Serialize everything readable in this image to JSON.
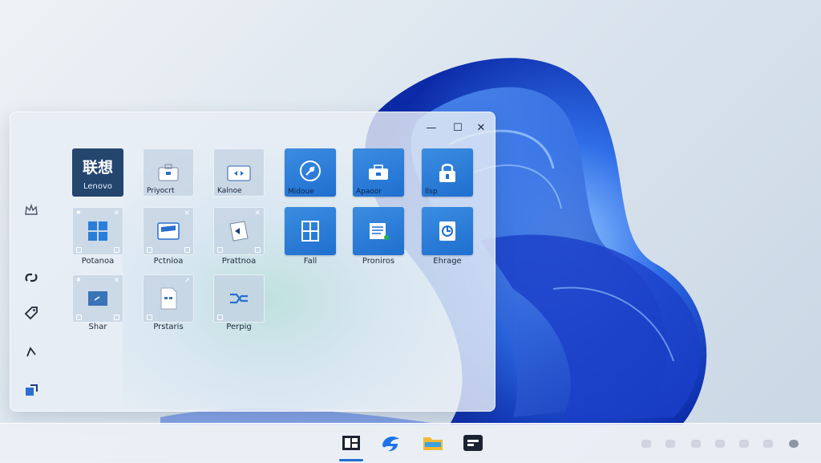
{
  "window": {
    "caption": {
      "minimize": "—",
      "maximize": "☐",
      "close": "✕"
    }
  },
  "rail": [
    {
      "icon": "crown-icon"
    },
    {
      "icon": "link-icon"
    },
    {
      "icon": "tag-icon"
    },
    {
      "icon": "cursor-icon"
    },
    {
      "icon": "export-icon"
    }
  ],
  "tiles": {
    "row1": [
      {
        "name": "lenovo",
        "cn": "联想",
        "en": "Lenovo"
      },
      {
        "name": "project",
        "label": "Priyocrt"
      },
      {
        "name": "kalnoe",
        "label": "Kalnoe"
      },
      {
        "name": "midoue",
        "label": "Midoue"
      },
      {
        "name": "apaoor",
        "label": "Apaoor"
      },
      {
        "name": "lock",
        "label": "Ilsp"
      }
    ],
    "row2": [
      {
        "name": "windows",
        "caption": "Potanoa"
      },
      {
        "name": "pctnioa",
        "caption": "Pctnioa"
      },
      {
        "name": "prattnoa",
        "caption": "Prattnoa"
      },
      {
        "name": "fall",
        "caption": "Fall"
      },
      {
        "name": "proniros",
        "caption": "Proniros"
      },
      {
        "name": "ehrage",
        "caption": "Ehrage"
      }
    ],
    "row3": [
      {
        "name": "shar",
        "caption": "Shar"
      },
      {
        "name": "prstaris",
        "caption": "Prstaris"
      },
      {
        "name": "perpig",
        "caption": "Perpig"
      }
    ]
  },
  "taskbar": {
    "apps": [
      {
        "name": "task-view",
        "icon": "windows-icon"
      },
      {
        "name": "edge",
        "icon": "edge-icon"
      },
      {
        "name": "explorer",
        "icon": "folder-icon"
      },
      {
        "name": "terminal",
        "icon": "terminal-icon"
      }
    ],
    "accent": "#1f6fd0"
  },
  "colors": {
    "tile_blue": "#2a7ed8",
    "brand": "#23456e",
    "bloom": "#1e4fd1"
  }
}
